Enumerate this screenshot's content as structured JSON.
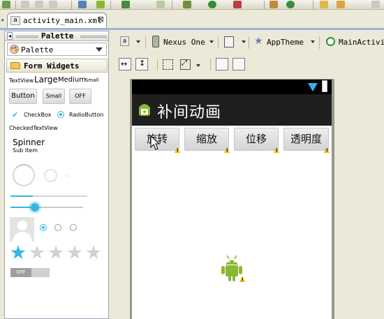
{
  "editor": {
    "tab_label": "activity_main.xml",
    "close_glyph": "⊠"
  },
  "palette": {
    "title": "Palette",
    "dropdown_label": "Palette",
    "section_label": "Form Widgets",
    "textview_sizes": [
      "TextView",
      "Large",
      "Medium",
      "Small"
    ],
    "buttons": [
      "Button",
      "Small",
      "OFF"
    ],
    "checkbox_label": "CheckBox",
    "radiobutton_label": "RadioButton",
    "checked_textview_label": "CheckedTextView",
    "spinner_label": "Spinner",
    "spinner_sub": "Sub Item",
    "switch_label": "OFF",
    "rating_stars_filled": 1,
    "rating_stars_total": 5
  },
  "canvas_toolbar": {
    "device": "Nexus One",
    "theme": "AppTheme",
    "activity": "MainActivit"
  },
  "app": {
    "title": "补间动画",
    "buttons": [
      "旋转",
      "缩放",
      "位移",
      "透明度"
    ]
  },
  "colors": {
    "accent_blue": "#33b5e5",
    "android_green": "#8ab833",
    "warning_yellow": "#e6b800"
  }
}
